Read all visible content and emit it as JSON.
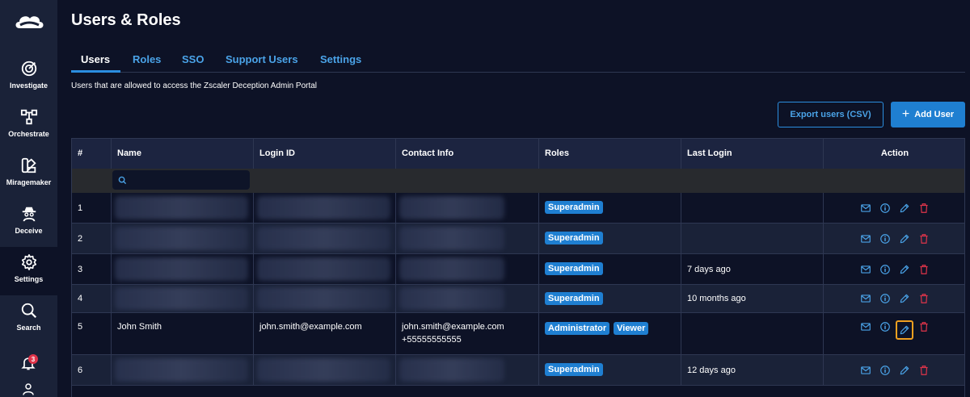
{
  "sidebar": {
    "items": [
      {
        "label": "Investigate",
        "icon": "target-icon"
      },
      {
        "label": "Orchestrate",
        "icon": "workflow-icon"
      },
      {
        "label": "Miragemaker",
        "icon": "palette-icon"
      },
      {
        "label": "Deceive",
        "icon": "spy-icon"
      },
      {
        "label": "Settings",
        "icon": "gear-icon"
      },
      {
        "label": "Search",
        "icon": "search-icon"
      }
    ],
    "notification_count": "3"
  },
  "page": {
    "title": "Users & Roles",
    "subtitle": "Users that are allowed to access the Zscaler Deception Admin Portal"
  },
  "tabs": [
    {
      "label": "Users",
      "active": true
    },
    {
      "label": "Roles"
    },
    {
      "label": "SSO"
    },
    {
      "label": "Support Users"
    },
    {
      "label": "Settings"
    }
  ],
  "toolbar": {
    "export_label": "Export users (CSV)",
    "add_label": "Add User"
  },
  "table": {
    "columns": [
      "#",
      "Name",
      "Login ID",
      "Contact Info",
      "Roles",
      "Last Login",
      "Action"
    ],
    "search_value": "",
    "rows": [
      {
        "num": "1",
        "name": "",
        "login": "",
        "contact": "",
        "contact2": "",
        "roles": [
          "Superadmin"
        ],
        "last_login": ""
      },
      {
        "num": "2",
        "name": "",
        "login": "",
        "contact": "",
        "contact2": "",
        "roles": [
          "Superadmin"
        ],
        "last_login": ""
      },
      {
        "num": "3",
        "name": "",
        "login": "",
        "contact": "",
        "contact2": "",
        "roles": [
          "Superadmin"
        ],
        "last_login": "7 days ago"
      },
      {
        "num": "4",
        "name": "",
        "login": "",
        "contact": "",
        "contact2": "",
        "roles": [
          "Superadmin"
        ],
        "last_login": "10 months ago"
      },
      {
        "num": "5",
        "name": "John Smith",
        "login": "john.smith@example.com",
        "contact": "john.smith@example.com",
        "contact2": "+55555555555",
        "roles": [
          "Administrator",
          "Viewer"
        ],
        "last_login": ""
      },
      {
        "num": "6",
        "name": "",
        "login": "",
        "contact": "",
        "contact2": "",
        "roles": [
          "Superadmin"
        ],
        "last_login": "12 days ago"
      }
    ]
  },
  "colors": {
    "background": "#0d1226",
    "accent": "#1f7fd1",
    "delete": "#e0344a",
    "highlight": "#f0a020"
  }
}
